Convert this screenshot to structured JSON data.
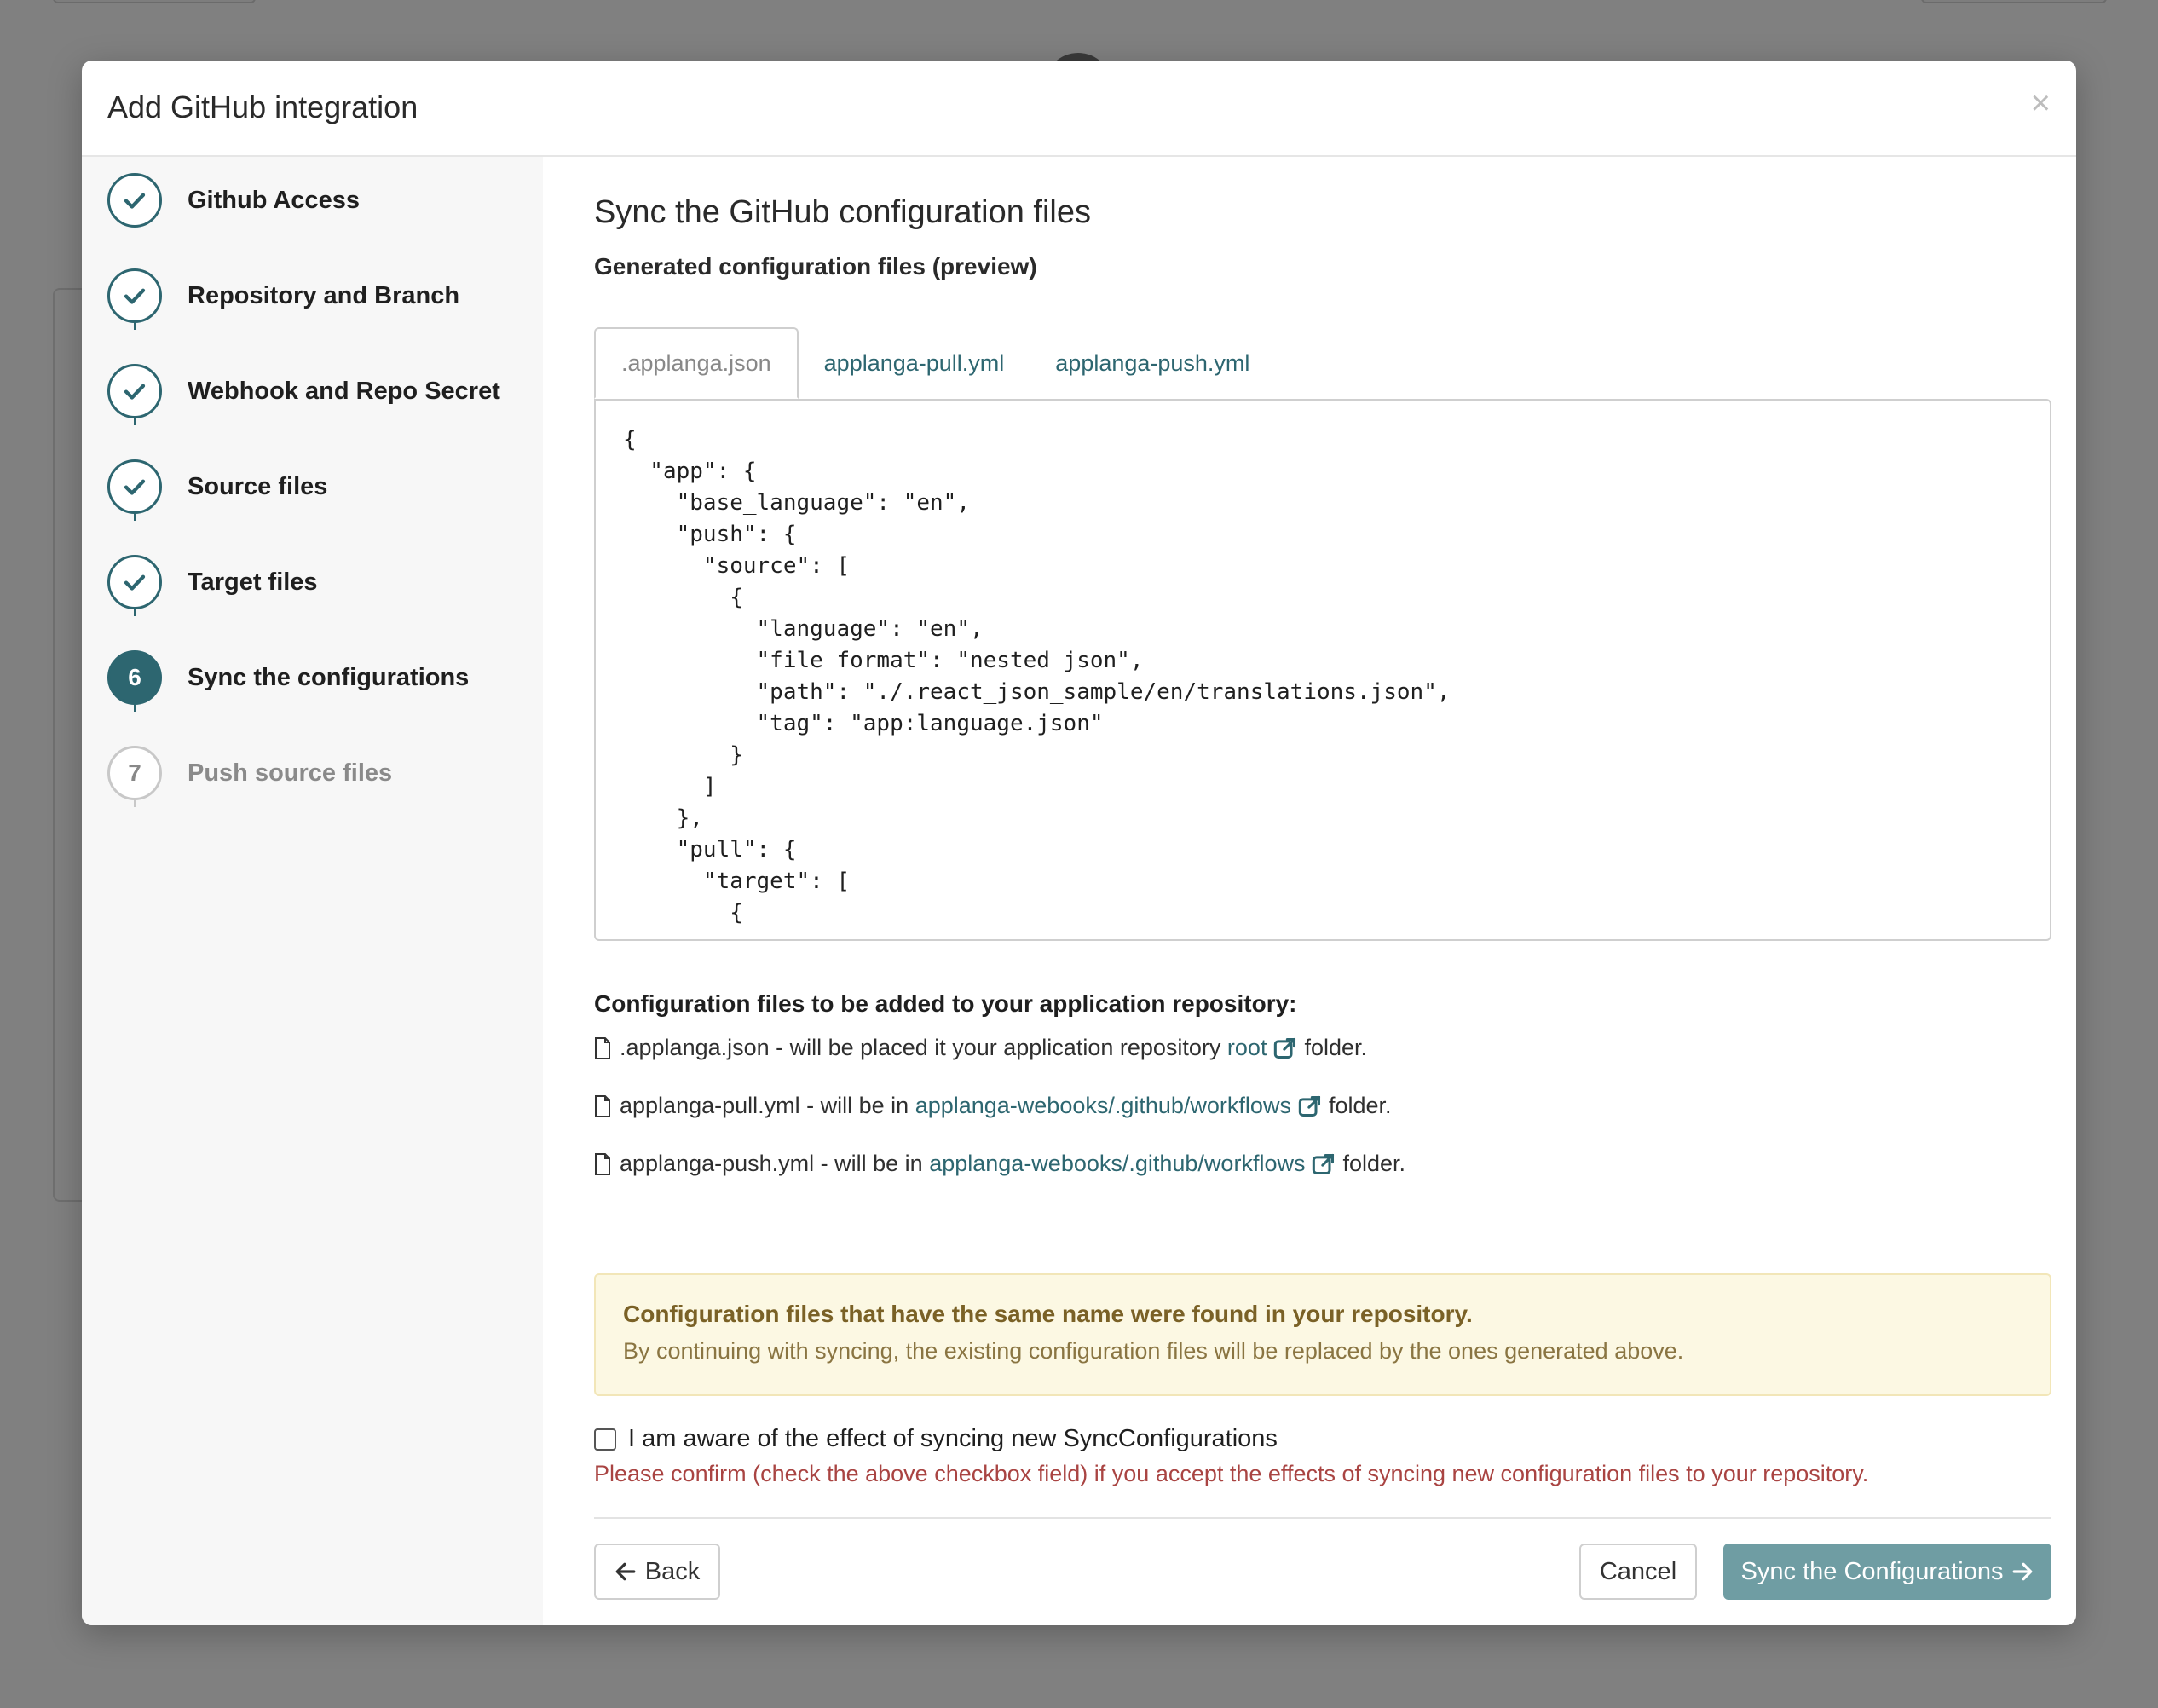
{
  "modal": {
    "title": "Add GitHub integration",
    "close_label": "×"
  },
  "steps": [
    {
      "number": "1",
      "label": "Github Access",
      "state": "done"
    },
    {
      "number": "2",
      "label": "Repository and Branch",
      "state": "done"
    },
    {
      "number": "3",
      "label": "Webhook and Repo Secret",
      "state": "done"
    },
    {
      "number": "4",
      "label": "Source files",
      "state": "done"
    },
    {
      "number": "5",
      "label": "Target files",
      "state": "done"
    },
    {
      "number": "6",
      "label": "Sync the configurations",
      "state": "active"
    },
    {
      "number": "7",
      "label": "Push source files",
      "state": "pending"
    }
  ],
  "content": {
    "title": "Sync the GitHub configuration files",
    "preview_title": "Generated configuration files (preview)",
    "tabs": [
      {
        "label": ".applanga.json",
        "active": true
      },
      {
        "label": "applanga-pull.yml",
        "active": false
      },
      {
        "label": "applanga-push.yml",
        "active": false
      }
    ],
    "code": "{\n  \"app\": {\n    \"base_language\": \"en\",\n    \"push\": {\n      \"source\": [\n        {\n          \"language\": \"en\",\n          \"file_format\": \"nested_json\",\n          \"path\": \"./.react_json_sample/en/translations.json\",\n          \"tag\": \"app:language.json\"\n        }\n      ]\n    },\n    \"pull\": {\n      \"target\": [\n        {",
    "add_title": "Configuration files to be added to your application repository:",
    "files": [
      {
        "text": ".applanga.json - will be placed it your application repository",
        "link": "root",
        "suffix": "folder."
      },
      {
        "text": "applanga-pull.yml - will be in",
        "link": "applanga-webooks/.github/workflows",
        "suffix": "folder."
      },
      {
        "text": "applanga-push.yml - will be in",
        "link": "applanga-webooks/.github/workflows",
        "suffix": "folder."
      }
    ],
    "alert": {
      "title": "Configuration files that have the same name were found in your repository.",
      "text": "By continuing with syncing, the existing configuration files will be replaced by the ones generated above."
    },
    "checkbox_label": "I am aware of the effect of syncing new SyncConfigurations",
    "checkbox_checked": false,
    "error_text": "Please confirm (check the above checkbox field) if you accept the effects of syncing new configuration files to your repository.",
    "buttons": {
      "back": "Back",
      "cancel": "Cancel",
      "sync": "Sync the Configurations"
    }
  },
  "colors": {
    "accent": "#2d6670",
    "accent_disabled": "#6f9da3",
    "error": "#a94442",
    "warning_bg": "#fcf8e3"
  }
}
